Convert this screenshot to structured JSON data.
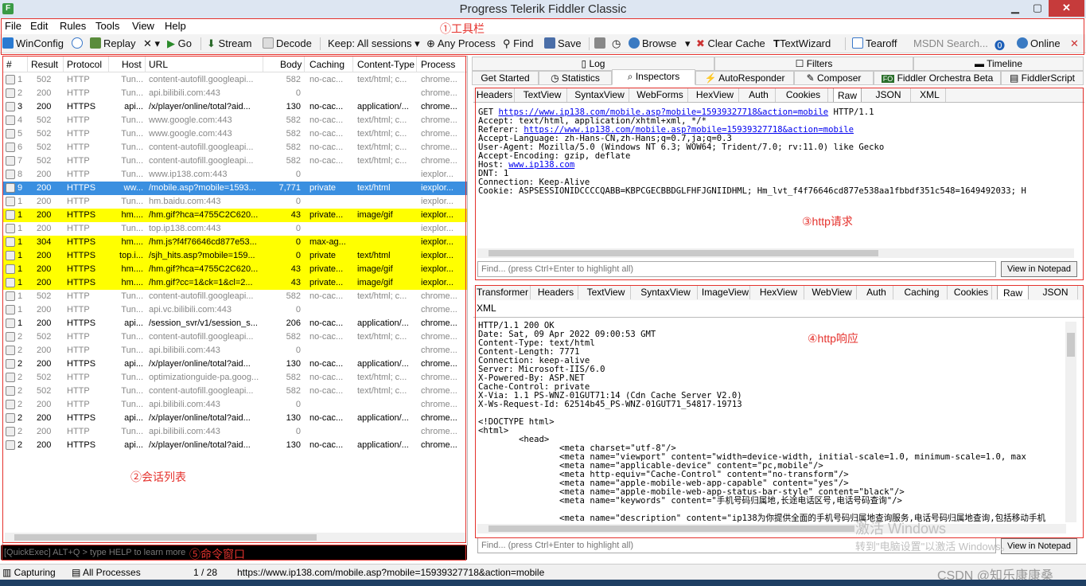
{
  "window": {
    "title": "Progress Telerik Fiddler Classic",
    "icon": "fiddler-logo-icon",
    "min": "▁",
    "max": "▢",
    "close": "✕"
  },
  "menu": [
    "File",
    "Edit",
    "Rules",
    "Tools",
    "View",
    "Help"
  ],
  "toolbar": {
    "winconfig": "WinConfig",
    "replay": "Replay",
    "remove": "✕ ▾",
    "go": "Go",
    "stream": "Stream",
    "decode": "Decode",
    "keep": "Keep: All sessions ▾",
    "any_process": "Any Process",
    "find": "Find",
    "save": "Save",
    "browse": "Browse",
    "browse_arrow": "▾",
    "clear_cache": "Clear Cache",
    "textwizard": "TextWizard",
    "tearoff": "Tearoff",
    "msdn": "MSDN Search...",
    "online": "Online",
    "close_x": "✕"
  },
  "annotations": {
    "a1": "①工具栏",
    "a2": "②会话列表",
    "a3": "③http请求",
    "a4": "④http响应",
    "a5": "⑤命令窗口"
  },
  "columns": [
    "#",
    "Result",
    "Protocol",
    "Host",
    "URL",
    "Body",
    "Caching",
    "Content-Type",
    "Process"
  ],
  "sessions": [
    {
      "id": "1",
      "result": "502",
      "protocol": "HTTP",
      "host": "Tun...",
      "url": "content-autofill.googleapi...",
      "body": "582",
      "caching": "no-cac...",
      "ctype": "text/html; c...",
      "process": "chrome...",
      "style": "grey"
    },
    {
      "id": "2",
      "result": "200",
      "protocol": "HTTP",
      "host": "Tun...",
      "url": "api.bilibili.com:443",
      "body": "0",
      "caching": "",
      "ctype": "",
      "process": "chrome...",
      "style": "grey"
    },
    {
      "id": "3",
      "result": "200",
      "protocol": "HTTPS",
      "host": "api...",
      "url": "/x/player/online/total?aid...",
      "body": "130",
      "caching": "no-cac...",
      "ctype": "application/...",
      "process": "chrome...",
      "style": "normal"
    },
    {
      "id": "4",
      "result": "502",
      "protocol": "HTTP",
      "host": "Tun...",
      "url": "www.google.com:443",
      "body": "582",
      "caching": "no-cac...",
      "ctype": "text/html; c...",
      "process": "chrome...",
      "style": "grey"
    },
    {
      "id": "5",
      "result": "502",
      "protocol": "HTTP",
      "host": "Tun...",
      "url": "www.google.com:443",
      "body": "582",
      "caching": "no-cac...",
      "ctype": "text/html; c...",
      "process": "chrome...",
      "style": "grey"
    },
    {
      "id": "6",
      "result": "502",
      "protocol": "HTTP",
      "host": "Tun...",
      "url": "content-autofill.googleapi...",
      "body": "582",
      "caching": "no-cac...",
      "ctype": "text/html; c...",
      "process": "chrome...",
      "style": "grey"
    },
    {
      "id": "7",
      "result": "502",
      "protocol": "HTTP",
      "host": "Tun...",
      "url": "content-autofill.googleapi...",
      "body": "582",
      "caching": "no-cac...",
      "ctype": "text/html; c...",
      "process": "chrome...",
      "style": "grey"
    },
    {
      "id": "8",
      "result": "200",
      "protocol": "HTTP",
      "host": "Tun...",
      "url": "www.ip138.com:443",
      "body": "0",
      "caching": "",
      "ctype": "",
      "process": "iexplor...",
      "style": "grey"
    },
    {
      "id": "9",
      "result": "200",
      "protocol": "HTTPS",
      "host": "ww...",
      "url": "/mobile.asp?mobile=1593...",
      "body": "7,771",
      "caching": "private",
      "ctype": "text/html",
      "process": "iexplor...",
      "style": "sel"
    },
    {
      "id": "1",
      "result": "200",
      "protocol": "HTTP",
      "host": "Tun...",
      "url": "hm.baidu.com:443",
      "body": "0",
      "caching": "",
      "ctype": "",
      "process": "iexplor...",
      "style": "grey"
    },
    {
      "id": "1",
      "result": "200",
      "protocol": "HTTPS",
      "host": "hm....",
      "url": "/hm.gif?hca=4755C2C620...",
      "body": "43",
      "caching": "private...",
      "ctype": "image/gif",
      "process": "iexplor...",
      "style": "yel"
    },
    {
      "id": "1",
      "result": "200",
      "protocol": "HTTP",
      "host": "Tun...",
      "url": "top.ip138.com:443",
      "body": "0",
      "caching": "",
      "ctype": "",
      "process": "iexplor...",
      "style": "grey"
    },
    {
      "id": "1",
      "result": "304",
      "protocol": "HTTPS",
      "host": "hm....",
      "url": "/hm.js?f4f76646cd877e53...",
      "body": "0",
      "caching": "max-ag...",
      "ctype": "",
      "process": "iexplor...",
      "style": "yel"
    },
    {
      "id": "1",
      "result": "200",
      "protocol": "HTTPS",
      "host": "top.i...",
      "url": "/sjh_hits.asp?mobile=159...",
      "body": "0",
      "caching": "private",
      "ctype": "text/html",
      "process": "iexplor...",
      "style": "yel"
    },
    {
      "id": "1",
      "result": "200",
      "protocol": "HTTPS",
      "host": "hm....",
      "url": "/hm.gif?hca=4755C2C620...",
      "body": "43",
      "caching": "private...",
      "ctype": "image/gif",
      "process": "iexplor...",
      "style": "yel"
    },
    {
      "id": "1",
      "result": "200",
      "protocol": "HTTPS",
      "host": "hm....",
      "url": "/hm.gif?cc=1&ck=1&cl=2...",
      "body": "43",
      "caching": "private...",
      "ctype": "image/gif",
      "process": "iexplor...",
      "style": "yel"
    },
    {
      "id": "1",
      "result": "502",
      "protocol": "HTTP",
      "host": "Tun...",
      "url": "content-autofill.googleapi...",
      "body": "582",
      "caching": "no-cac...",
      "ctype": "text/html; c...",
      "process": "chrome...",
      "style": "grey"
    },
    {
      "id": "1",
      "result": "200",
      "protocol": "HTTP",
      "host": "Tun...",
      "url": "api.vc.bilibili.com:443",
      "body": "0",
      "caching": "",
      "ctype": "",
      "process": "chrome...",
      "style": "grey"
    },
    {
      "id": "1",
      "result": "200",
      "protocol": "HTTPS",
      "host": "api...",
      "url": "/session_svr/v1/session_s...",
      "body": "206",
      "caching": "no-cac...",
      "ctype": "application/...",
      "process": "chrome...",
      "style": "normal"
    },
    {
      "id": "2",
      "result": "502",
      "protocol": "HTTP",
      "host": "Tun...",
      "url": "content-autofill.googleapi...",
      "body": "582",
      "caching": "no-cac...",
      "ctype": "text/html; c...",
      "process": "chrome...",
      "style": "grey"
    },
    {
      "id": "2",
      "result": "200",
      "protocol": "HTTP",
      "host": "Tun...",
      "url": "api.bilibili.com:443",
      "body": "0",
      "caching": "",
      "ctype": "",
      "process": "chrome...",
      "style": "grey"
    },
    {
      "id": "2",
      "result": "200",
      "protocol": "HTTPS",
      "host": "api...",
      "url": "/x/player/online/total?aid...",
      "body": "130",
      "caching": "no-cac...",
      "ctype": "application/...",
      "process": "chrome...",
      "style": "normal"
    },
    {
      "id": "2",
      "result": "502",
      "protocol": "HTTP",
      "host": "Tun...",
      "url": "optimizationguide-pa.goog...",
      "body": "582",
      "caching": "no-cac...",
      "ctype": "text/html; c...",
      "process": "chrome...",
      "style": "grey"
    },
    {
      "id": "2",
      "result": "502",
      "protocol": "HTTP",
      "host": "Tun...",
      "url": "content-autofill.googleapi...",
      "body": "582",
      "caching": "no-cac...",
      "ctype": "text/html; c...",
      "process": "chrome...",
      "style": "grey"
    },
    {
      "id": "2",
      "result": "200",
      "protocol": "HTTP",
      "host": "Tun...",
      "url": "api.bilibili.com:443",
      "body": "0",
      "caching": "",
      "ctype": "",
      "process": "chrome...",
      "style": "grey"
    },
    {
      "id": "2",
      "result": "200",
      "protocol": "HTTPS",
      "host": "api...",
      "url": "/x/player/online/total?aid...",
      "body": "130",
      "caching": "no-cac...",
      "ctype": "application/...",
      "process": "chrome...",
      "style": "normal"
    },
    {
      "id": "2",
      "result": "200",
      "protocol": "HTTP",
      "host": "Tun...",
      "url": "api.bilibili.com:443",
      "body": "0",
      "caching": "",
      "ctype": "",
      "process": "chrome...",
      "style": "grey"
    },
    {
      "id": "2",
      "result": "200",
      "protocol": "HTTPS",
      "host": "api...",
      "url": "/x/player/online/total?aid...",
      "body": "130",
      "caching": "no-cac...",
      "ctype": "application/...",
      "process": "chrome...",
      "style": "normal"
    }
  ],
  "quickexec": "[QuickExec] ALT+Q > type HELP to learn more",
  "status": {
    "capturing": "Capturing",
    "processes": "All Processes",
    "count": "1 / 28",
    "url": "https://www.ip138.com/mobile.asp?mobile=15939327718&action=mobile"
  },
  "top_tabs_row1": [
    "Log",
    "Filters",
    "Timeline"
  ],
  "top_tabs_row2": [
    "Get Started",
    "Statistics",
    "Inspectors",
    "AutoResponder",
    "Composer",
    "Fiddler Orchestra Beta",
    "FiddlerScript"
  ],
  "request_tabs": [
    "Headers",
    "TextView",
    "SyntaxView",
    "WebForms",
    "HexView",
    "Auth",
    "Cookies",
    "Raw",
    "JSON",
    "XML"
  ],
  "request": {
    "get": "GET ",
    "url": "https://www.ip138.com/mobile.asp?mobile=15939327718&action=mobile",
    "ver": " HTTP/1.1",
    "accept": "Accept: text/html, application/xhtml+xml, */*",
    "referer_label": "Referer: ",
    "referer": "https://www.ip138.com/mobile.asp?mobile=15939327718&action=mobile",
    "lang": "Accept-Language: zh-Hans-CN,zh-Hans;q=0.7,ja;q=0.3",
    "ua": "User-Agent: Mozilla/5.0 (Windows NT 6.3; WOW64; Trident/7.0; rv:11.0) like Gecko",
    "enc": "Accept-Encoding: gzip, deflate",
    "host_label": "Host: ",
    "host": "www.ip138.com",
    "dnt": "DNT: 1",
    "conn": "Connection: Keep-Alive",
    "cookie": "Cookie: ASPSESSIONIDCCCCQABB=KBPCGECBBDGLFHFJGNIIDHML; Hm_lvt_f4f76646cd877e538aa1fbbdf351c548=1649492033; H"
  },
  "find_placeholder": "Find... (press Ctrl+Enter to highlight all)",
  "notepad": "View in Notepad",
  "response_tabs": [
    "Transformer",
    "Headers",
    "TextView",
    "SyntaxView",
    "ImageView",
    "HexView",
    "WebView",
    "Auth",
    "Caching",
    "Cookies",
    "Raw",
    "JSON"
  ],
  "response_tab_xml": "XML",
  "response": "HTTP/1.1 200 OK\nDate: Sat, 09 Apr 2022 09:00:53 GMT\nContent-Type: text/html\nContent-Length: 7771\nConnection: keep-alive\nServer: Microsoft-IIS/6.0\nX-Powered-By: ASP.NET\nCache-Control: private\nX-Via: 1.1 PS-WNZ-01GUT71:14 (Cdn Cache Server V2.0)\nX-Ws-Request-Id: 62514b45_PS-WNZ-01GUT71_54817-19713\n\n<!DOCTYPE html>\n<html>\n        <head>\n                <meta charset=\"utf-8\"/>\n                <meta name=\"viewport\" content=\"width=device-width, initial-scale=1.0, minimum-scale=1.0, max\n                <meta name=\"applicable-device\" content=\"pc,mobile\"/>\n                <meta http-equiv=\"Cache-Control\" content=\"no-transform\"/>\n                <meta name=\"apple-mobile-web-app-capable\" content=\"yes\"/>\n                <meta name=\"apple-mobile-web-app-status-bar-style\" content=\"black\"/>\n                <meta name=\"keywords\" content=\"手机号码归属地,长途电话区号,电话号码查询\"/>\n\n                <meta name=\"description\" content=\"ip138为你提供全面的手机号码归属地查询服务,电话号码归属地查询,包括移动手机",
  "watermark": {
    "activate": "激活 Windows",
    "goto": "转到\"电脑设置\"以激活 Windows。",
    "csdn": "CSDN @知乐康康桑"
  }
}
